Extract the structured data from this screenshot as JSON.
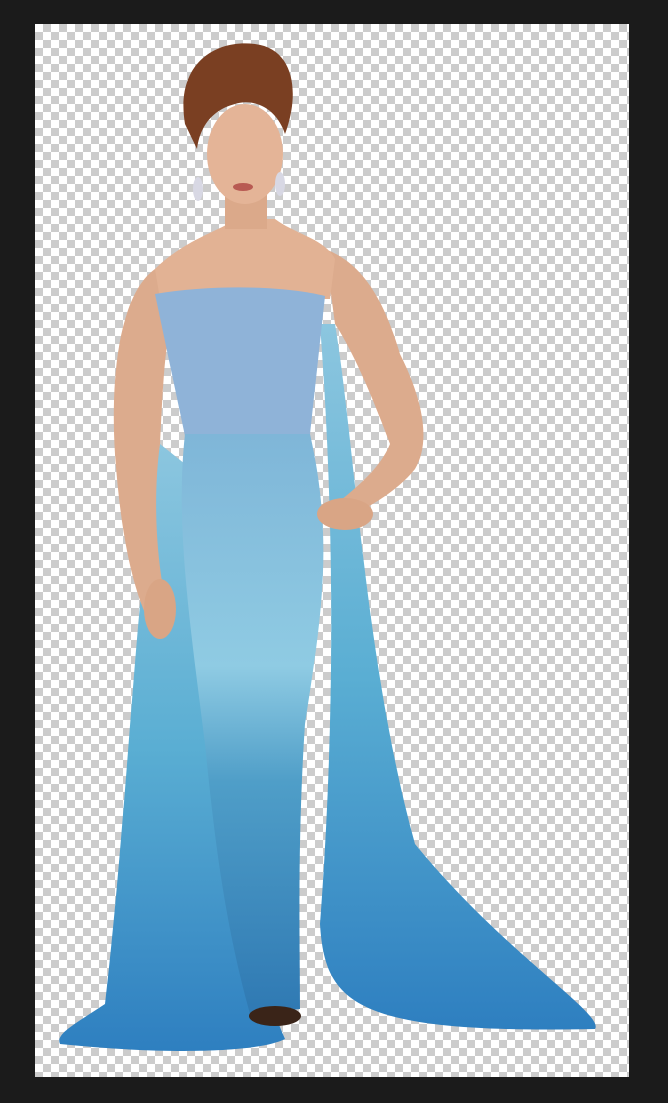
{
  "image": {
    "frame_color": "#1b1b1b",
    "transparency_checker_colors": [
      "#ffffff",
      "#cccccc"
    ],
    "dress_color": "#5fb0d6",
    "hair_color": "#7a3f22",
    "skin_color": "#e2b294"
  }
}
